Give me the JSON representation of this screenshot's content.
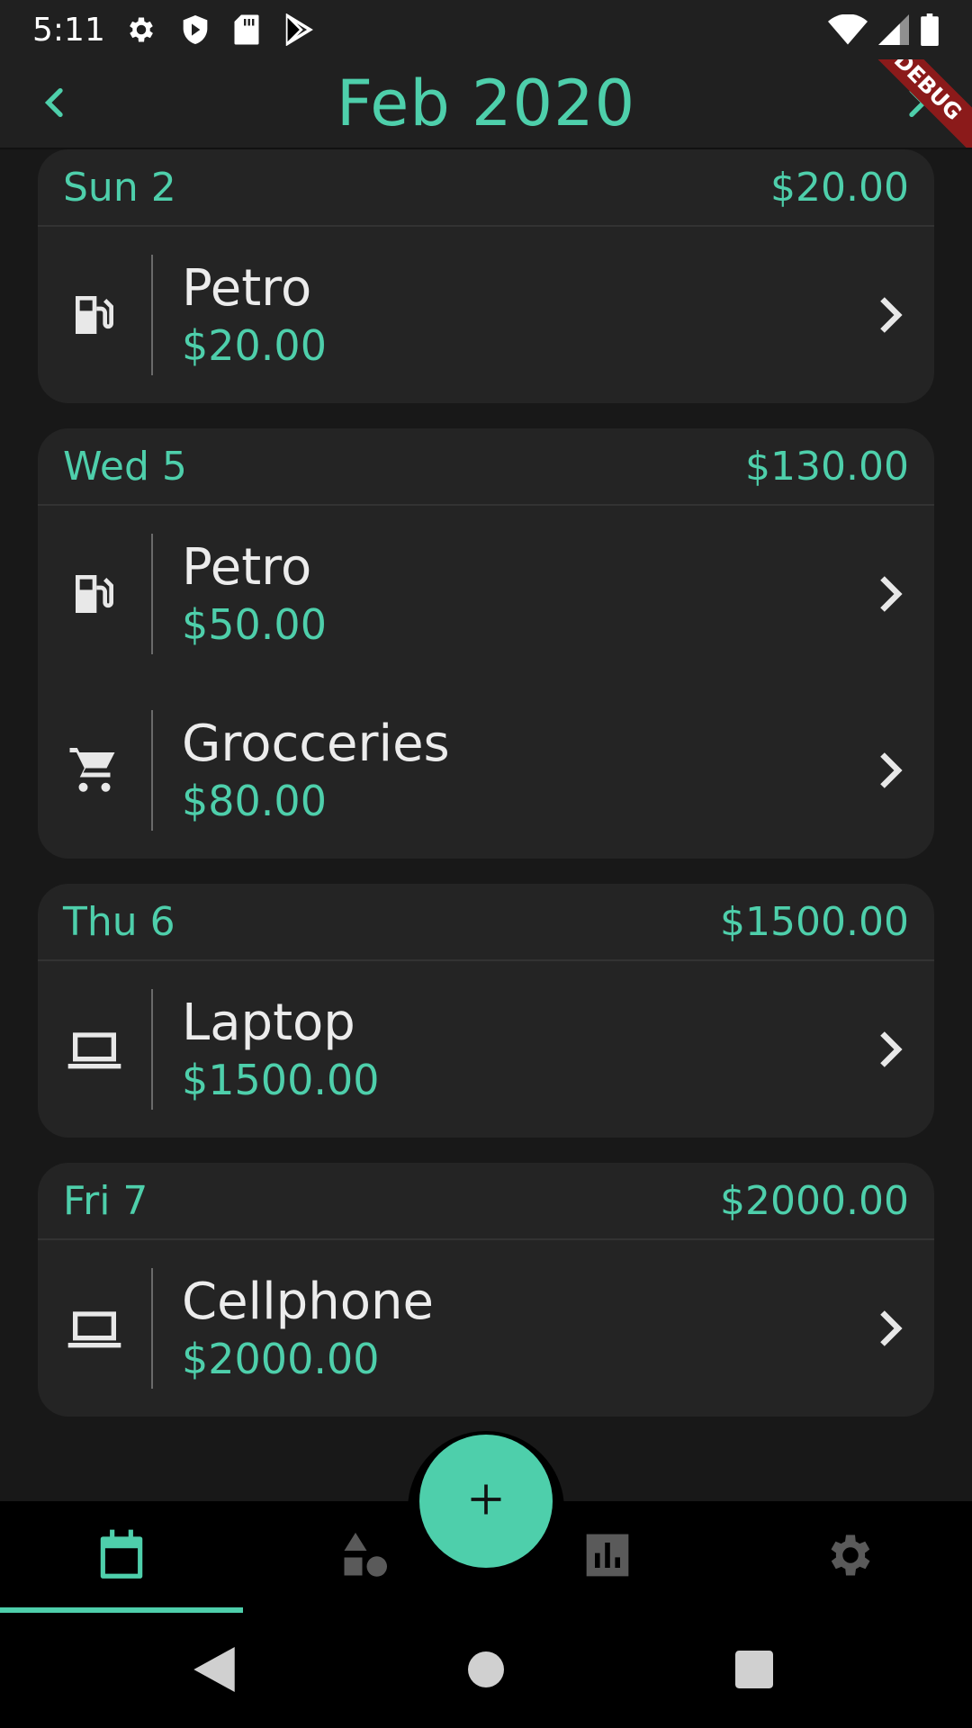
{
  "status_bar": {
    "time": "5:11",
    "icons_left": [
      "gear-icon",
      "shield-icon",
      "sd-card-icon",
      "play-store-icon"
    ],
    "icons_right": [
      "wifi-icon",
      "signal-icon",
      "battery-icon"
    ]
  },
  "app_bar": {
    "title": "Feb 2020",
    "prev_icon": "chevron-left-icon",
    "next_icon": "chevron-right-icon",
    "debug_banner": "DEBUG"
  },
  "days": [
    {
      "label": "Sun 2",
      "total": "$20.00",
      "transactions": [
        {
          "name": "Petro",
          "amount": "$20.00",
          "icon": "gas-station-icon"
        }
      ]
    },
    {
      "label": "Wed 5",
      "total": "$130.00",
      "transactions": [
        {
          "name": "Petro",
          "amount": "$50.00",
          "icon": "gas-station-icon"
        },
        {
          "name": "Grocceries",
          "amount": "$80.00",
          "icon": "shopping-cart-icon"
        }
      ]
    },
    {
      "label": "Thu 6",
      "total": "$1500.00",
      "transactions": [
        {
          "name": "Laptop",
          "amount": "$1500.00",
          "icon": "laptop-icon"
        }
      ]
    },
    {
      "label": "Fri 7",
      "total": "$2000.00",
      "transactions": [
        {
          "name": "Cellphone",
          "amount": "$2000.00",
          "icon": "laptop-icon"
        }
      ]
    }
  ],
  "fab": {
    "icon": "plus-icon"
  },
  "bottom_nav": {
    "items": [
      "calendar-icon",
      "categories-icon",
      "bar-chart-icon",
      "gear-icon"
    ],
    "active_index": 0
  },
  "system_nav": [
    "back-icon",
    "home-icon",
    "recents-icon"
  ],
  "colors": {
    "accent": "#4ecfab",
    "card": "#242424",
    "background": "#181818"
  }
}
